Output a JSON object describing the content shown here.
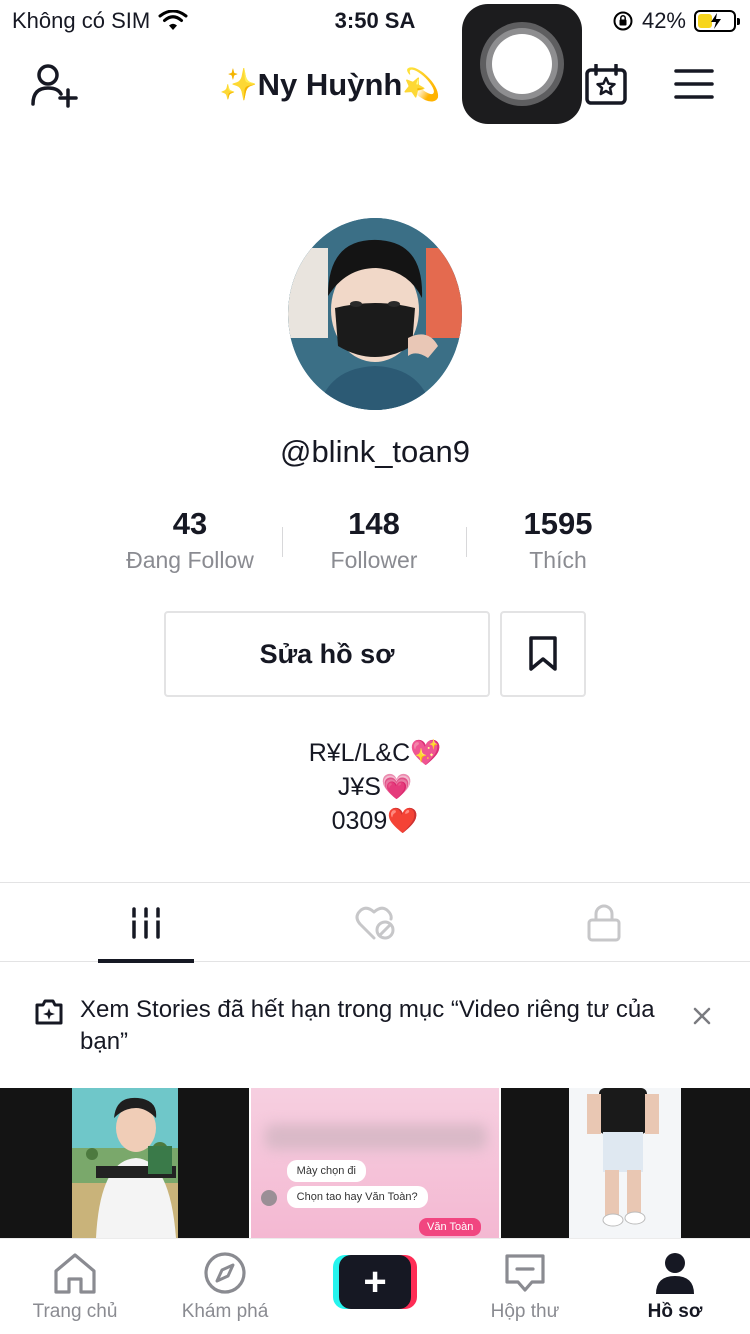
{
  "status_bar": {
    "carrier": "Không có SIM",
    "time": "3:50 SA",
    "battery_percent": "42%",
    "battery_level": 0.42,
    "icons": [
      "wifi-icon",
      "orientation-lock-icon",
      "battery-charging-icon"
    ]
  },
  "header": {
    "title": "✨Ny Huỳnh💫",
    "icons": [
      "add-user-icon",
      "calendar-star-icon",
      "menu-icon"
    ]
  },
  "profile": {
    "username": "@blink_toan9",
    "stats": [
      {
        "value": "43",
        "label": "Đang Follow"
      },
      {
        "value": "148",
        "label": "Follower"
      },
      {
        "value": "1595",
        "label": "Thích"
      }
    ],
    "edit_label": "Sửa hồ sơ",
    "bio_lines": [
      "R¥L/L&C💖",
      "J¥S💗",
      "0309❤️"
    ]
  },
  "tabs": [
    {
      "icon": "grid-icon",
      "active": true
    },
    {
      "icon": "liked-hidden-icon",
      "active": false
    },
    {
      "icon": "lock-icon",
      "active": false
    }
  ],
  "stories_banner": {
    "text": "Xem Stories đã hết hạn trong mục “Video riêng tư của bạn”",
    "close": "×"
  },
  "videos": {
    "chat_question": "Mày chọn đi",
    "chat_option": "Chọn tao hay Văn Toàn?",
    "chat_answer": "Văn Toàn"
  },
  "bottom_nav": [
    {
      "label": "Trang chủ",
      "icon": "home-icon",
      "active": false
    },
    {
      "label": "Khám phá",
      "icon": "compass-icon",
      "active": false
    },
    {
      "label": "",
      "icon": "plus-icon",
      "active": false
    },
    {
      "label": "Hộp thư",
      "icon": "inbox-icon",
      "active": false
    },
    {
      "label": "Hồ sơ",
      "icon": "profile-icon",
      "active": true
    }
  ],
  "colors": {
    "text": "#161823",
    "muted": "#8a8b91",
    "accent_cyan": "#25f4ee",
    "accent_red": "#fe2c55",
    "battery": "#f7d51d"
  }
}
